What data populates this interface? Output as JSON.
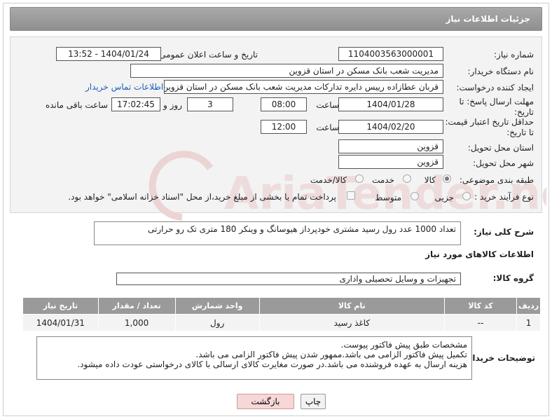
{
  "header": {
    "title": "جزئیات اطلاعات نیاز"
  },
  "form": {
    "need_number_label": "شماره نیاز:",
    "need_number": "1104003563000001",
    "announce_label": "تاریخ و ساعت اعلان عمومی:",
    "announce_value": "1404/01/24 - 13:52",
    "buyer_org_label": "نام دستگاه خریدار:",
    "buyer_org": "مدیریت شعب بانک مسکن در استان قزوین",
    "creator_label": "ایجاد کننده درخواست:",
    "creator": "قربان عطازاده رییس دایره تدارکات مدیریت شعب بانک مسکن در استان قزوین",
    "contact_link": "اطلاعات تماس خریدار",
    "deadline_label": "مهلت ارسال پاسخ: تا تاریخ:",
    "deadline_date": "1404/01/28",
    "time_label": "ساعت",
    "deadline_time": "08:00",
    "days_value": "3",
    "days_label": "روز و",
    "remaining_time": "17:02:45",
    "remaining_label": "ساعت باقی مانده",
    "price_validity_label": "حداقل تاریخ اعتبار قیمت: تا تاریخ:",
    "price_validity_date": "1404/02/20",
    "price_validity_time": "12:00",
    "province_label": "استان محل تحویل:",
    "province": "قزوین",
    "city_label": "شهر محل تحویل:",
    "city": "قزوین",
    "category_label": "طبقه بندی موضوعی:",
    "category_options": [
      "کالا",
      "خدمت",
      "کالا/خدمت"
    ],
    "purchase_type_label": "نوع فرآیند خرید :",
    "purchase_options": [
      "جزیی",
      "متوسط"
    ],
    "payment_note": "پرداخت تمام یا بخشی از مبلغ خرید،از محل \"اسناد خزانه اسلامی\" خواهد بود."
  },
  "description": {
    "label": "شرح کلی نیاز:",
    "text": "تعداد 1000 عدد رول رسید مشتری خودپرداز هیوسانگ و وینکر 180 متری تک رو حرارتی"
  },
  "goods": {
    "section_title": "اطلاعات کالاهای مورد نیاز",
    "group_label": "گروه کالا:",
    "group_value": "تجهیزات و وسایل تحصیلی واداری",
    "columns": [
      "ردیف",
      "کد کالا",
      "نام کالا",
      "واحد شمارش",
      "تعداد / مقدار",
      "تاریخ نیاز"
    ],
    "rows": [
      {
        "row": "1",
        "code": "--",
        "name": "کاغذ رسید",
        "unit": "رول",
        "qty": "1,000",
        "date": "1404/01/31"
      }
    ]
  },
  "notes": {
    "label": "توضیحات خریدار:",
    "lines": [
      "مشخصات طبق پیش فاکتور پیوست.",
      "تکمیل پیش فاکتور الزامی می باشد.ممهور شدن پیش فاکتور الزامی می باشد.",
      "هزینه ارسال به عهده فروشنده می باشد.در صورت مغایرت کالای ارسالی با کالای درخواستی عودت داده میشود."
    ]
  },
  "buttons": {
    "print": "چاپ",
    "back": "بازگشت"
  },
  "watermark": {
    "text": "AriaTender.net"
  },
  "colors": {
    "header": "#9a9a9a",
    "panel": "#f3f3f3",
    "link": "#1a5fb4",
    "back_button": "#f7d7d7",
    "watermark": "#e6c9c9"
  }
}
